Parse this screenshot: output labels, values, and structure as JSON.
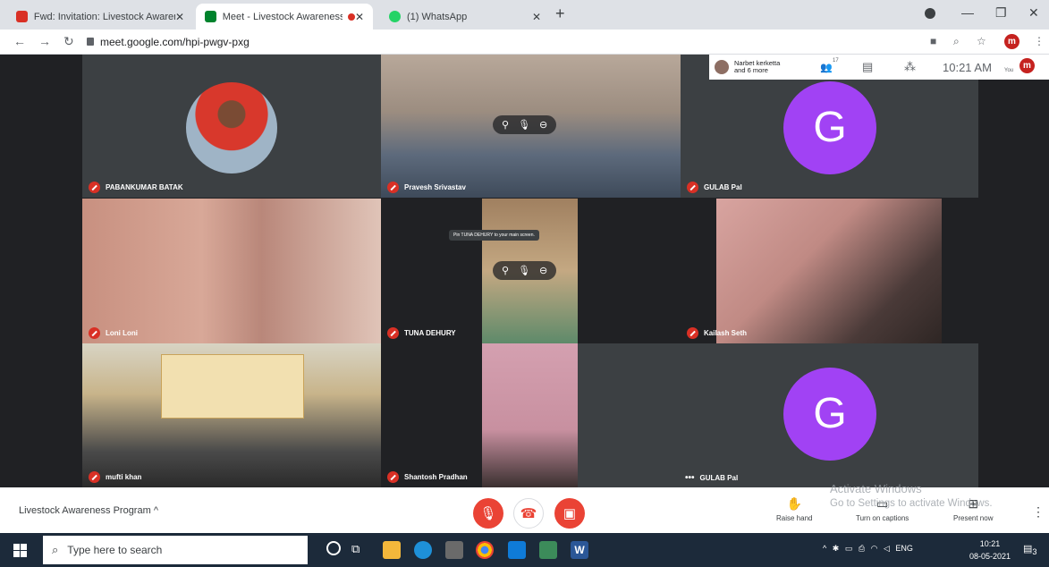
{
  "browser": {
    "tabs": [
      {
        "title": "Fwd: Invitation: Livestock Awarer",
        "color": "#d93025"
      },
      {
        "title": "Meet - Livestock Awareness",
        "color": "#00832d"
      },
      {
        "title": "(1) WhatsApp",
        "color": "#25d366"
      }
    ],
    "new_tab_glyph": "+",
    "url": "meet.google.com/hpi-pwgv-pxg",
    "profile_initial": "m"
  },
  "meet": {
    "participants_pill": {
      "line1": "Narbet kerketta",
      "line2": "and 6 more"
    },
    "people_count": "17",
    "time": "10:21 AM",
    "you_label": "You",
    "tiles": [
      {
        "name": "PABANKUMAR BATAK",
        "kind": "photo-avatar"
      },
      {
        "name": "Pravesh Srivastav",
        "kind": "video"
      },
      {
        "name": "GULAB Pal",
        "kind": "letter-avatar",
        "letter": "G"
      },
      {
        "name": "Loni Loni",
        "kind": "video"
      },
      {
        "name": "TUNA DEHURY",
        "kind": "video"
      },
      {
        "name": "Kailash Seth",
        "kind": "video"
      },
      {
        "name": "mufti khan",
        "kind": "video"
      },
      {
        "name": "Shantosh Pradhan",
        "kind": "video"
      },
      {
        "name": "GULAB Pal",
        "kind": "letter-avatar",
        "letter": "G"
      }
    ],
    "tooltip": "Pin TUNA DEHURY to your main screen.",
    "meeting_title": "Livestock Awareness Program",
    "raise_hand": "Raise hand",
    "captions": "Turn on captions",
    "present": "Present now",
    "watermark": {
      "line1": "Activate Windows",
      "line2": "Go to Settings to activate Windows."
    }
  },
  "taskbar": {
    "search_placeholder": "Type here to search",
    "lang": "ENG",
    "time": "10:21",
    "date": "08-05-2021",
    "notif_count": "3"
  }
}
